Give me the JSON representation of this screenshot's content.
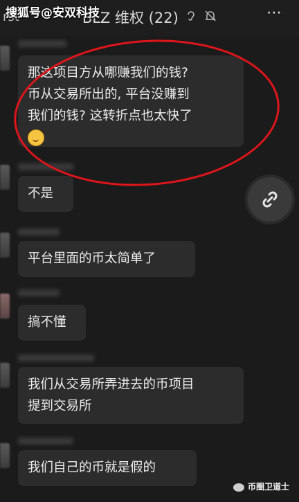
{
  "header": {
    "back_fragment": "rst",
    "title": "BLZ 维权 (22)",
    "more": "⋯"
  },
  "icons": {
    "ear": "ear-icon",
    "mute": "bell-off-icon",
    "link": "link-icon"
  },
  "watermark": {
    "top": "搜狐号@安双科技",
    "bottom": "币圈卫道士"
  },
  "messages": [
    {
      "text_lines": [
        "那这项目方从哪赚我们的钱?",
        "币从交易所出的, 平台没赚到",
        "我们的钱? 这转折点也太快了"
      ],
      "emoji": "smiling-emoji"
    },
    {
      "text": "不是"
    },
    {
      "text": "平台里面的币太简单了"
    },
    {
      "text": "搞不懂"
    },
    {
      "text_lines": [
        "我们从交易所弄进去的币项目",
        "提到交易所"
      ]
    },
    {
      "text": "我们自己的币就是假的"
    }
  ],
  "colors": {
    "background": "#1b1b1b",
    "bubble": "#2c2c2c",
    "annotation": "#e0151b"
  }
}
